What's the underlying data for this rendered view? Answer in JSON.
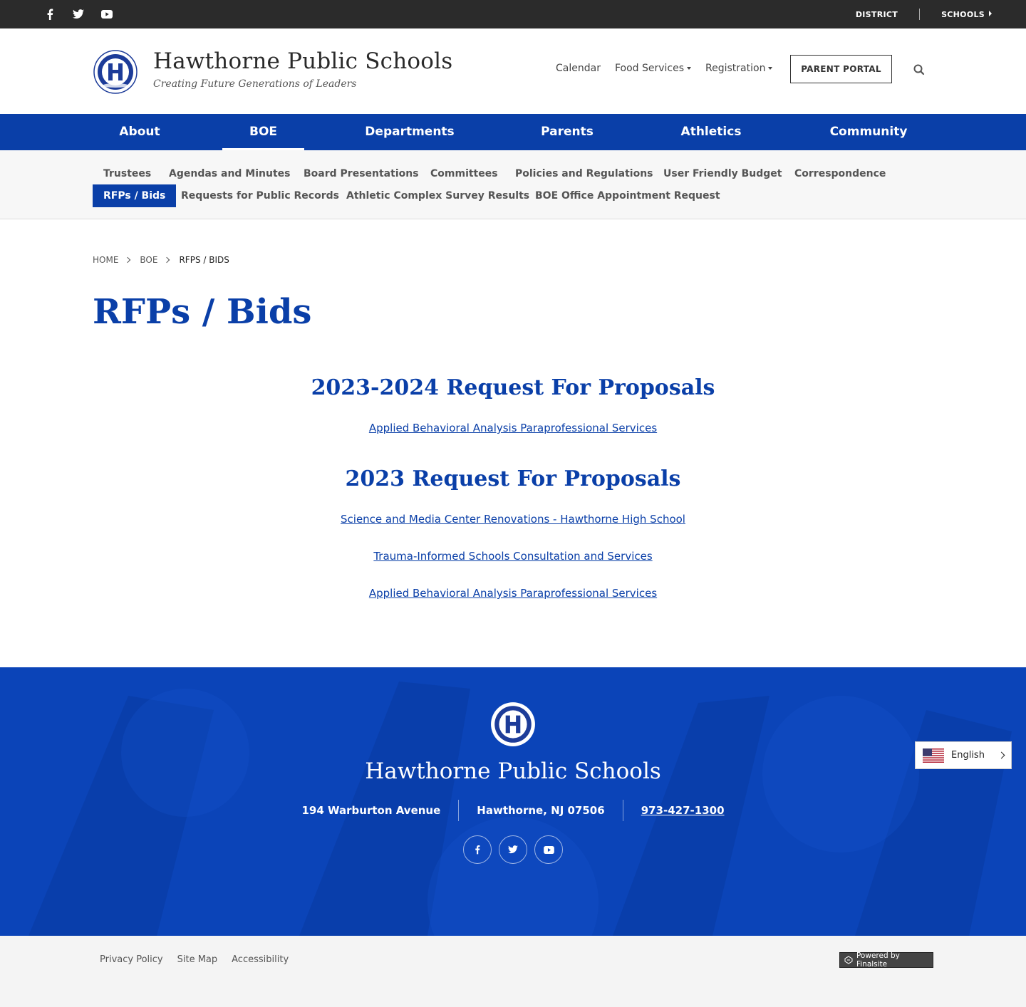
{
  "topbar": {
    "social": [
      "facebook-icon",
      "twitter-icon",
      "youtube-icon"
    ],
    "district_label": "DISTRICT",
    "schools_label": "SCHOOLS"
  },
  "header": {
    "title": "Hawthorne Public Schools",
    "tagline": "Creating Future Generations of Leaders",
    "links": {
      "calendar": "Calendar",
      "food_services": "Food Services",
      "registration": "Registration"
    },
    "portal_button": "PARENT PORTAL"
  },
  "mainnav": {
    "about": "About",
    "boe": "BOE",
    "departments": "Departments",
    "parents": "Parents",
    "athletics": "Athletics",
    "community": "Community"
  },
  "subnav": {
    "trustees": "Trustees",
    "agendas": "Agendas and Minutes",
    "board_presentations": "Board Presentations",
    "committees": "Committees",
    "policies": "Policies and Regulations",
    "budget": "User Friendly Budget",
    "correspondence": "Correspondence",
    "rfps": "RFPs / Bids",
    "public_records": "Requests for Public Records",
    "survey": "Athletic Complex Survey Results",
    "appointment": "BOE Office Appointment Request"
  },
  "breadcrumb": {
    "home": "HOME",
    "boe": "BOE",
    "current": "RFPS / BIDS"
  },
  "page": {
    "title": "RFPs / Bids",
    "section1": {
      "heading": "2023-2024 Request For Proposals",
      "links": [
        "Applied Behavioral Analysis Paraprofessional Services"
      ]
    },
    "section2": {
      "heading": "2023 Request For Proposals",
      "links": [
        "Science and Media Center Renovations - Hawthorne High School",
        "Trauma-Informed Schools Consultation and Services",
        "Applied Behavioral Analysis Paraprofessional Services"
      ]
    }
  },
  "footer": {
    "title": "Hawthorne Public Schools",
    "address": "194 Warburton Avenue",
    "city": "Hawthorne, NJ  07506",
    "phone": "973-427-1300",
    "language": "English"
  },
  "bottombar": {
    "privacy": "Privacy Policy",
    "sitemap": "Site Map",
    "accessibility": "Accessibility",
    "powered": "Powered by Finalsite"
  },
  "colors": {
    "brand_blue": "#0a3fa8",
    "footer_blue": "#0b44b8",
    "topbar": "#2b2b2b"
  }
}
